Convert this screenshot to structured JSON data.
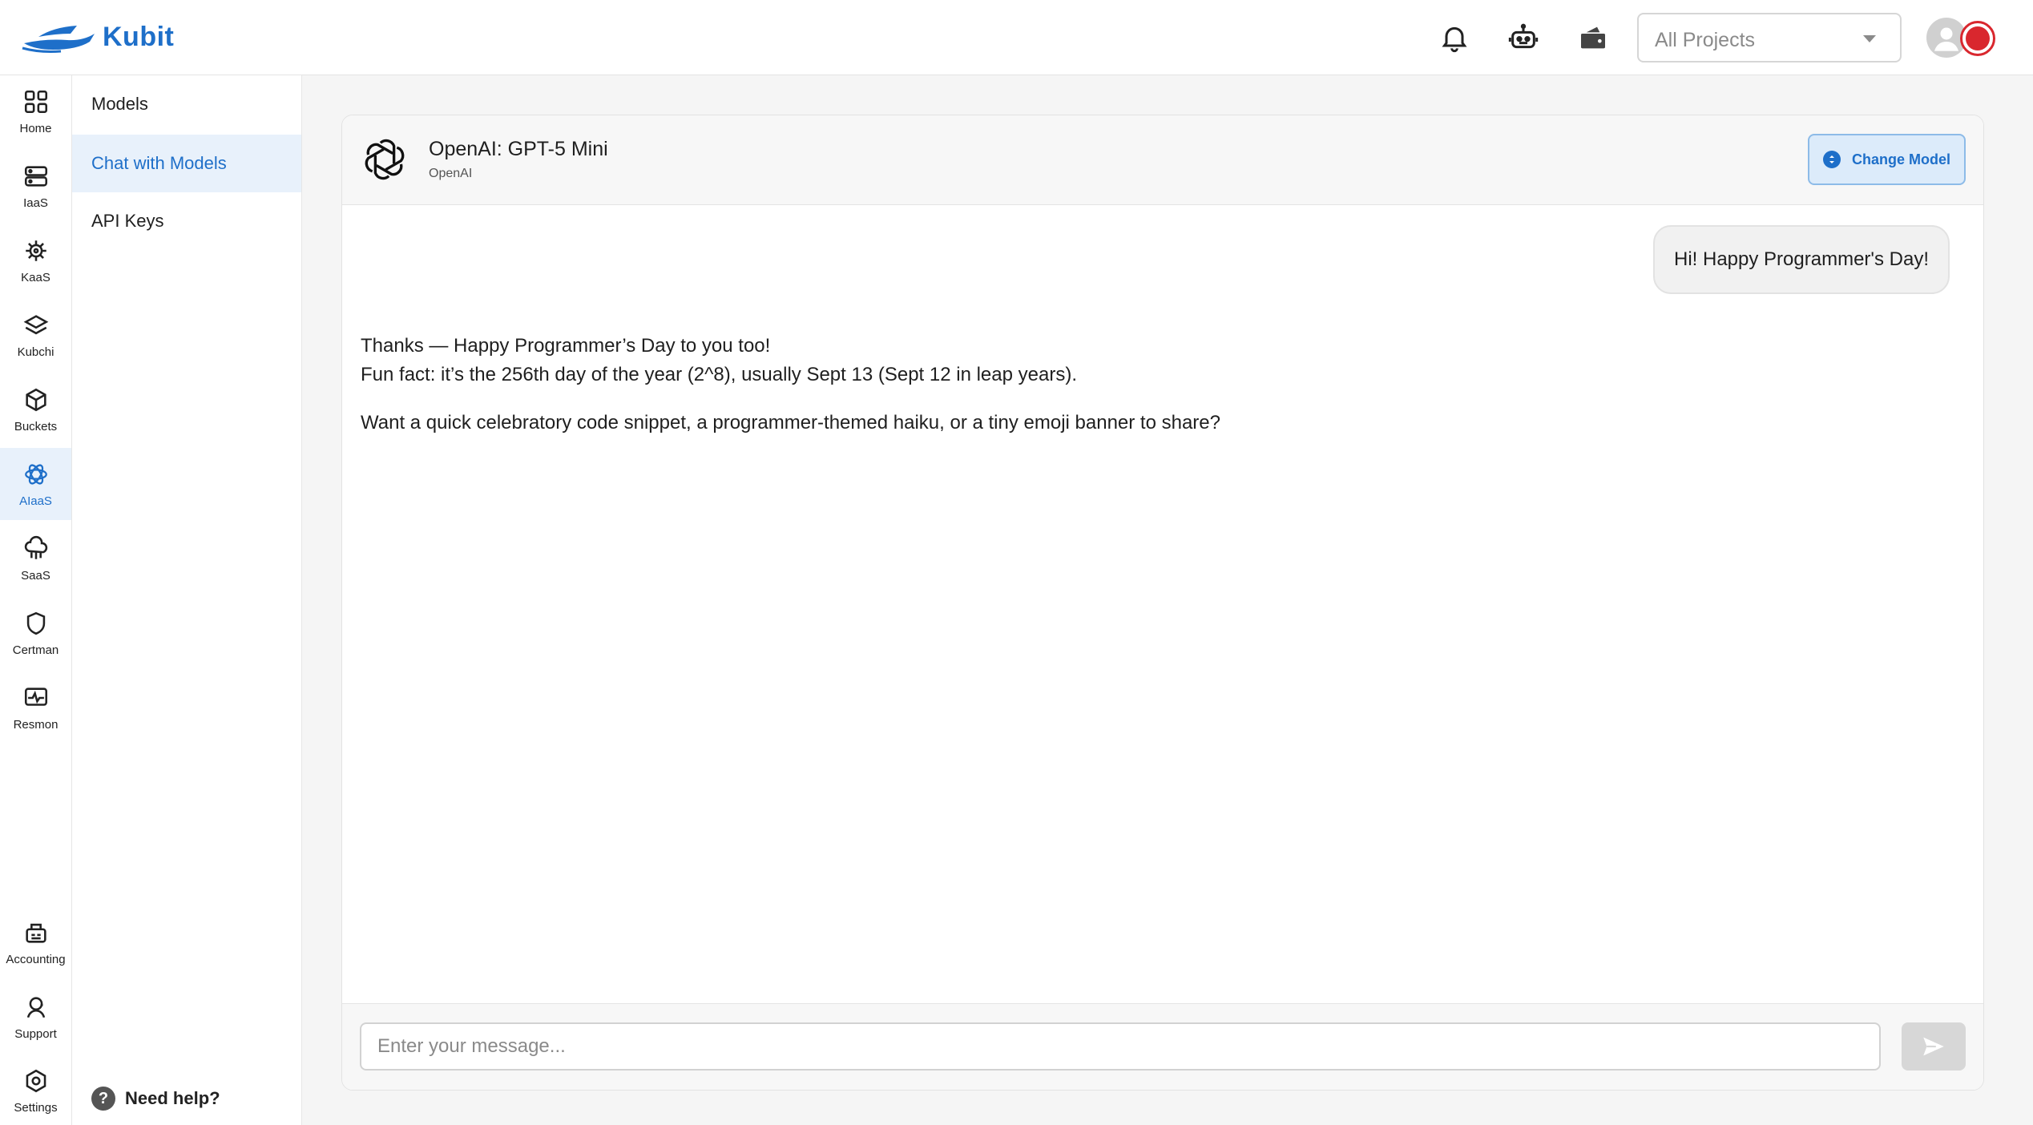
{
  "brand": {
    "name": "Kubit",
    "accent": "#1e6fc9"
  },
  "topbar": {
    "icons": [
      "bell-icon",
      "robot-icon",
      "wallet-icon"
    ],
    "project_select": {
      "value": "All Projects"
    }
  },
  "rail": {
    "items": [
      {
        "label": "Home",
        "icon": "home-grid-icon"
      },
      {
        "label": "IaaS",
        "icon": "server-icon"
      },
      {
        "label": "KaaS",
        "icon": "helm-wheel-icon"
      },
      {
        "label": "Kubchi",
        "icon": "layers-icon"
      },
      {
        "label": "Buckets",
        "icon": "box-icon"
      },
      {
        "label": "AIaaS",
        "icon": "ai-brain-icon"
      },
      {
        "label": "SaaS",
        "icon": "cloud-icon"
      },
      {
        "label": "Certman",
        "icon": "shield-icon"
      },
      {
        "label": "Resmon",
        "icon": "monitor-icon"
      }
    ],
    "bottom_items": [
      {
        "label": "Accounting",
        "icon": "accounting-icon"
      },
      {
        "label": "Support",
        "icon": "support-icon"
      },
      {
        "label": "Settings",
        "icon": "gear-icon"
      }
    ],
    "active": "AIaaS"
  },
  "subnav": {
    "items": [
      "Models",
      "Chat with Models",
      "API Keys"
    ],
    "active": "Chat with Models",
    "help": "Need help?"
  },
  "chat": {
    "model_name": "OpenAI: GPT-5 Mini",
    "provider": "OpenAI",
    "change_model_label": "Change Model",
    "messages": [
      {
        "role": "user",
        "text": "Hi! Happy Programmer's Day!"
      },
      {
        "role": "assistant",
        "line1": "Thanks — Happy Programmer’s Day to you too!",
        "line2": "Fun fact: it’s the 256th day of the year (2^8), usually Sept 13 (Sept 12 in leap years).",
        "line3": "Want a quick celebratory code snippet, a programmer-themed haiku, or a tiny emoji banner to share?"
      }
    ],
    "input_placeholder": "Enter your message..."
  }
}
